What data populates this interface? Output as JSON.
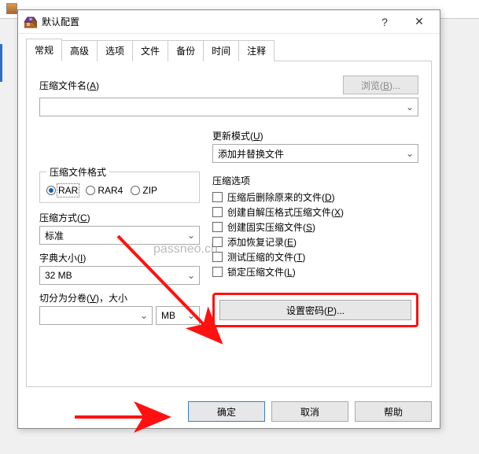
{
  "titlebar": {
    "title": "默认配置",
    "help": "?",
    "close": "✕"
  },
  "tabs": [
    "常规",
    "高级",
    "选项",
    "文件",
    "备份",
    "时间",
    "注释"
  ],
  "archive": {
    "label": "压缩文件名(A)",
    "browse": "浏览(B)...",
    "value": ""
  },
  "update": {
    "label": "更新模式(U)",
    "value": "添加并替换文件"
  },
  "format": {
    "legend": "压缩文件格式",
    "options": [
      "RAR",
      "RAR4",
      "ZIP"
    ],
    "selected": "RAR"
  },
  "method": {
    "label": "压缩方式(C)",
    "value": "标准"
  },
  "dict": {
    "label": "字典大小(I)",
    "value": "32 MB"
  },
  "volume": {
    "label": "切分为分卷(V)，大小",
    "value": "",
    "unit": "MB"
  },
  "options": {
    "title": "压缩选项",
    "items": [
      "压缩后删除原来的文件(D)",
      "创建自解压格式压缩文件(X)",
      "创建固实压缩文件(S)",
      "添加恢复记录(E)",
      "测试压缩的文件(T)",
      "锁定压缩文件(L)"
    ]
  },
  "password_btn": "设置密码(P)...",
  "footer": {
    "ok": "确定",
    "cancel": "取消",
    "help": "帮助"
  },
  "watermark": "passneo.ch"
}
